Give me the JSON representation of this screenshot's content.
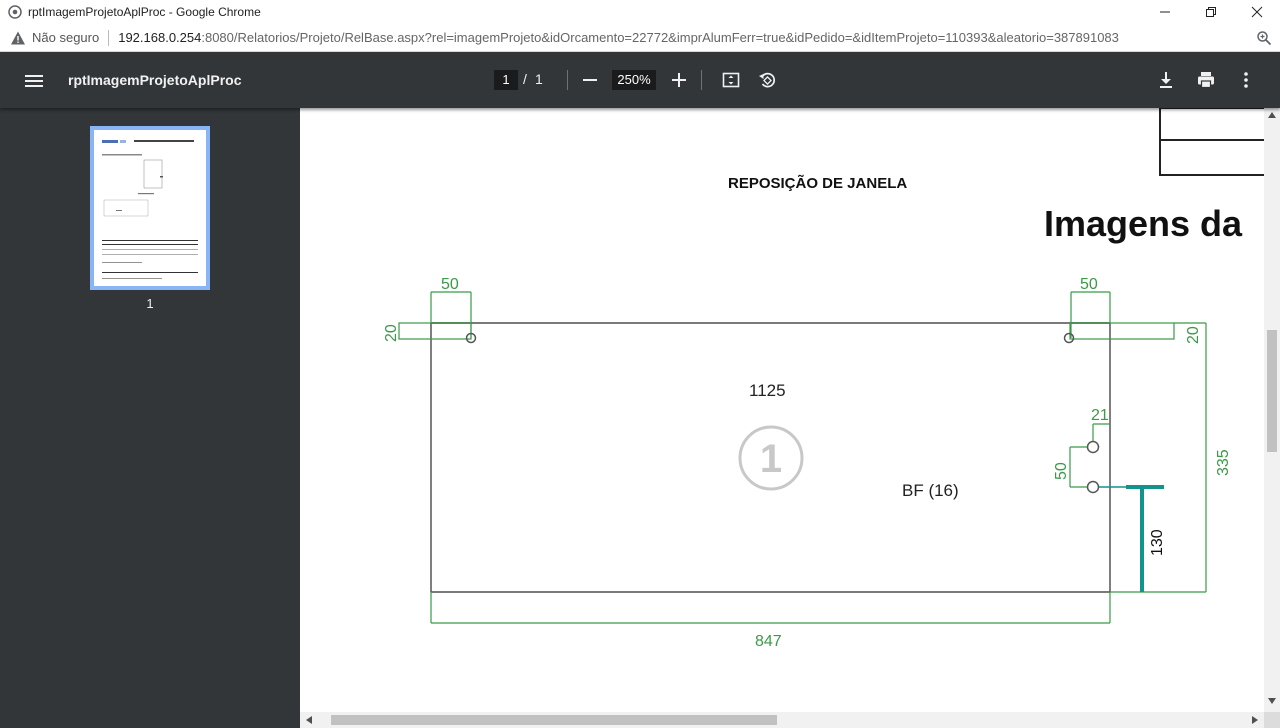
{
  "window": {
    "title": "rptImagemProjetoAplProc - Google Chrome"
  },
  "address": {
    "security_label": "Não seguro",
    "url_host": "192.168.0.254",
    "url_rest": ":8080/Relatorios/Projeto/RelBase.aspx?rel=imagemProjeto&idOrcamento=22772&imprAlumFerr=true&idPedido=&idItemProjeto=110393&aleatorio=387891083"
  },
  "viewer": {
    "doc_title": "rptImagemProjetoAplProc",
    "current_page": "1",
    "page_separator": "/",
    "total_pages": "1",
    "zoom": "250%",
    "thumbnail_number": "1"
  },
  "drawing": {
    "heading": "REPOSIÇÃO DE JANELA",
    "side_heading": "Imagens da",
    "dim_top_left": "50",
    "dim_top_right": "50",
    "dim_left_20": "20",
    "dim_right_20": "20",
    "dim_width_label": "1125",
    "piece_number": "1",
    "dim_21": "21",
    "dim_50_vert": "50",
    "dim_335": "335",
    "bf_label": "BF (16)",
    "dim_130": "130",
    "dim_847": "847"
  },
  "colors": {
    "dim_green": "#3a9a48",
    "teal": "#12938c",
    "line_gray": "#7a7a7a"
  }
}
